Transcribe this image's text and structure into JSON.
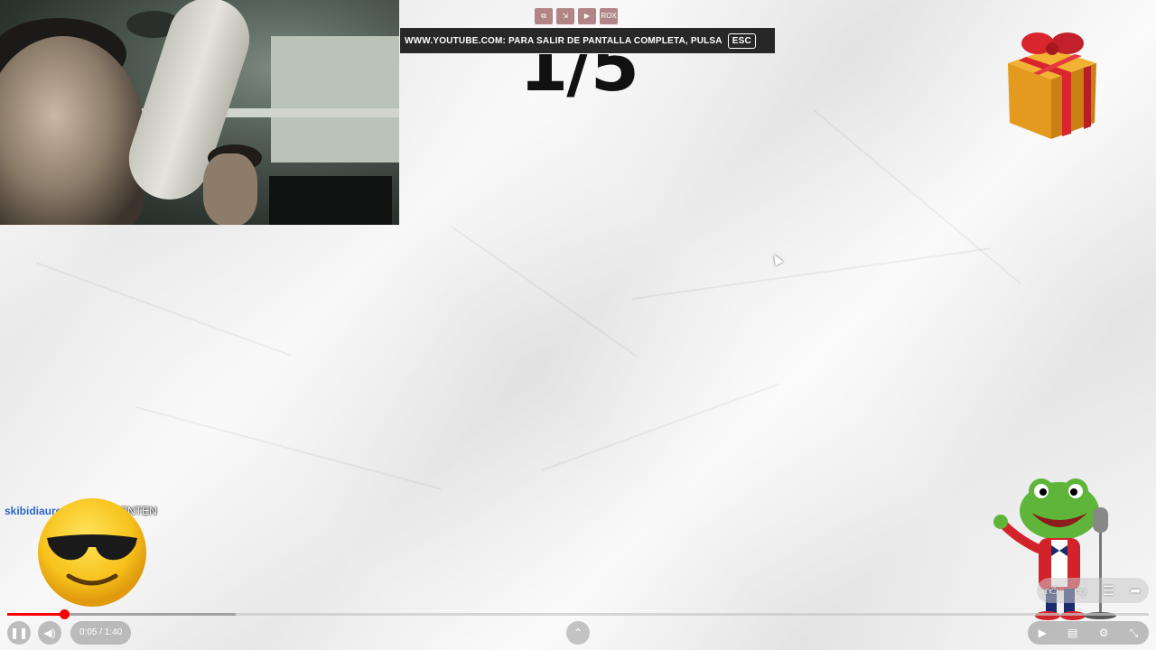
{
  "fullscreen_notice": {
    "text": "WWW.YOUTUBE.COM: PARA SALIR DE PANTALLA COMPLETA, PULSA",
    "key": "ESC",
    "mini_icons": [
      "exit-icon",
      "window-icon",
      "next-icon",
      "box-label"
    ],
    "box_label": "ROX"
  },
  "counter": {
    "text": "1/5"
  },
  "chat": {
    "username": "skibidiaurea123",
    "separator": " : ",
    "message": "COMENTEN"
  },
  "player": {
    "time": "0:05 / 1:40",
    "progress_fraction": 0.05,
    "buffer_fraction": 0.2,
    "play_pause_icon": "pause-icon",
    "volume_icon": "volume-icon",
    "up_icon": "chevron-up-icon",
    "colors": {
      "played": "#ff0000"
    }
  },
  "actions": [
    "like-icon",
    "dislike-icon",
    "comment-icon",
    "share-icon"
  ],
  "right_controls": [
    "autoplay-icon",
    "subtitles-icon",
    "settings-icon",
    "exit-fullscreen-icon"
  ]
}
